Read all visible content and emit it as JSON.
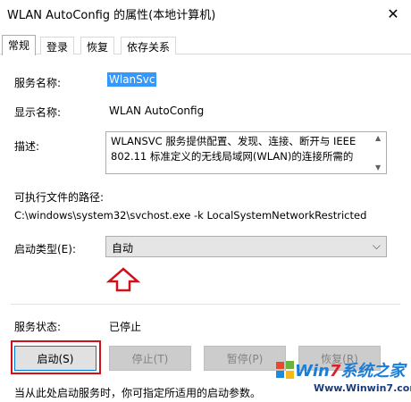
{
  "window": {
    "title": "WLAN AutoConfig 的属性(本地计算机)",
    "close_glyph": "✕"
  },
  "tabs": [
    {
      "label": "常规",
      "active": true
    },
    {
      "label": "登录",
      "active": false
    },
    {
      "label": "恢复",
      "active": false
    },
    {
      "label": "依存关系",
      "active": false
    }
  ],
  "general": {
    "service_name_label": "服务名称:",
    "service_name": "WlanSvc",
    "display_name_label": "显示名称:",
    "display_name": "WLAN AutoConfig",
    "description_label": "描述:",
    "description_line1": "WLANSVC 服务提供配置、发现、连接、断开与 IEEE",
    "description_line2": "802.11 标准定义的无线局域网(WLAN)的连接所需的",
    "exec_path_label": "可执行文件的路径:",
    "exec_path": "C:\\windows\\system32\\svchost.exe -k LocalSystemNetworkRestricted",
    "startup_type_label": "启动类型(E):",
    "startup_type_value": "自动",
    "service_status_label": "服务状态:",
    "service_status": "已停止",
    "footer_note": "当从此处启动服务时，你可指定所适用的启动参数。"
  },
  "buttons": {
    "start": "启动(S)",
    "stop": "停止(T)",
    "pause": "暂停(P)",
    "resume": "恢复(R)"
  },
  "watermark": {
    "brand_pre": "Win",
    "brand_seven": "7",
    "brand_post": "系统之家",
    "url": "Www.Winwin7.com"
  },
  "colors": {
    "highlight_red": "#d0101a",
    "selection_blue": "#3399ff"
  },
  "icons": {
    "close": "close-icon",
    "combo_arrow": "chevron-down-icon",
    "hint": "up-arrow-icon",
    "scroll_up": "scroll-up-icon",
    "scroll_down": "scroll-down-icon"
  }
}
